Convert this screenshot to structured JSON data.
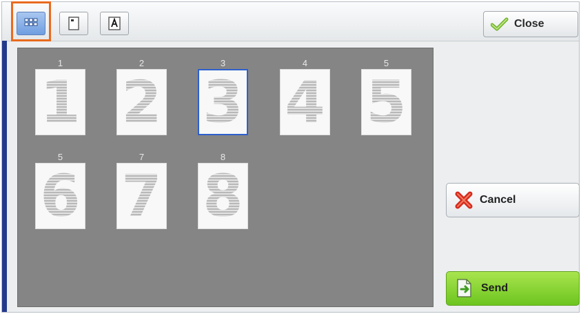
{
  "toolbar": {
    "view_buttons": [
      {
        "icon": "thumbnail-grid-icon",
        "selected": true
      },
      {
        "icon": "page-view-icon",
        "selected": false
      },
      {
        "icon": "text-view-icon",
        "selected": false
      }
    ],
    "close_label": "Close",
    "highlight_color": "#e96a1e"
  },
  "pages": [
    {
      "num": "1",
      "glyph": "1",
      "selected": false
    },
    {
      "num": "2",
      "glyph": "2",
      "selected": false
    },
    {
      "num": "3",
      "glyph": "3",
      "selected": true
    },
    {
      "num": "4",
      "glyph": "4",
      "selected": false
    },
    {
      "num": "5",
      "glyph": "5",
      "selected": false
    },
    {
      "num": "5",
      "glyph": "6",
      "selected": false
    },
    {
      "num": "7",
      "glyph": "7",
      "selected": false
    },
    {
      "num": "8",
      "glyph": "8",
      "selected": false
    }
  ],
  "actions": {
    "cancel_label": "Cancel",
    "send_label": "Send"
  },
  "colors": {
    "accent_blue": "#2d5fce",
    "send_green": "#6cc51f",
    "cancel_red": "#d52b1e"
  }
}
